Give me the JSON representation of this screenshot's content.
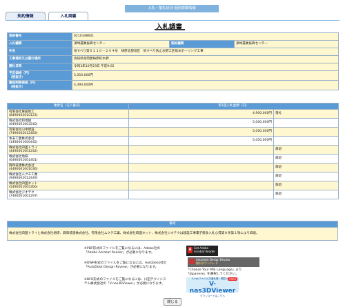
{
  "header": {
    "banner": "入札・落札状況-個別詳細情報"
  },
  "tabs": [
    {
      "label": "契約情報"
    },
    {
      "label": "入札調書"
    }
  ],
  "page_title": "入札調書",
  "info": {
    "contract_no_label": "契約番号",
    "contract_no": "0210348601",
    "bid_agency_label": "入札機関",
    "bid_agency": "須崎農業振興センター",
    "contract_agency_label": "契約機関",
    "contract_agency": "須崎農業振興センター",
    "project_label": "件名",
    "project": "地すべり第６２１０－２０４号　梼原北部地区　地すべり防止水野工区排水ボーリング工事",
    "location_label": "工事場所又は履行場所",
    "location": "高知県高岡郡梼原町水野",
    "opening_label": "開札日時",
    "opening": "令和3年10月29日 午前9:02",
    "planned_price_label": "予定価格（円）",
    "planned_price_sub": "（税抜き）",
    "planned_price": "5,050,000円",
    "min_price_label": "最低制限価格（円）",
    "min_price_sub": "（税抜き）",
    "min_price": "4,390,000円"
  },
  "bids": {
    "col_company": "業者名（法人番号）",
    "col_amount": "第1回入札金額（円）",
    "rows": [
      {
        "name": "有限会社東田地工",
        "corp": "(8490002010123)",
        "amount": "4,900,000円",
        "result": "落札"
      },
      {
        "name": "株式会社和地組",
        "corp": "(6490001003240)",
        "amount": "5,000,000円",
        "result": ""
      },
      {
        "name": "有限会社山中建設",
        "corp": "(7490002012483)",
        "amount": "5,000,000円",
        "result": ""
      },
      {
        "name": "本末工業株式会社",
        "corp": "(1490001000445)",
        "amount": "5,050,000円",
        "result": ""
      },
      {
        "name": "株式会社四国トライ",
        "corp": "(4490001001242)",
        "amount": "",
        "result": "辞退"
      },
      {
        "name": "株式会社地研",
        "corp": "(6490001001461)",
        "amount": "",
        "result": "辞退"
      },
      {
        "name": "興和技建株式会社",
        "corp": "(4490001001036)",
        "amount": "",
        "result": "辞退"
      },
      {
        "name": "株式会社ムクチ工業",
        "corp": "(9490002012449)",
        "amount": "",
        "result": "辞退"
      },
      {
        "name": "株式会社四国ネット",
        "corp": "(5490001005366)",
        "amount": "",
        "result": "辞退"
      },
      {
        "name": "株式会社ジオテク",
        "corp": "(7490001001297)",
        "amount": "",
        "result": "辞退"
      }
    ]
  },
  "remarks": {
    "label": "備考",
    "text": "株式会社四国トライと株式会社地研、興和技建株式会社、有限会社ムクチ工業、株式会社四国ネット、株式会社ジオテクは建設工事電子競争入札心得第８条第１項により辞退。"
  },
  "notes": {
    "pdf": [
      "※PDF形式のファイルをご覧になるには、Adobe社の",
      "「Adobe Acrobat Reader」が必要になります。"
    ],
    "dwf": [
      "※DWF形式のファイルをご覧になるには、AutoDesk社の",
      "「AutoDesk Design Review」が必要になります。"
    ],
    "bfo": [
      "※BFO形式のファイルをご覧になるには、川田テクノシス",
      "テム株式会社の「V-nas3DViewer」が必要になります。"
    ],
    "autodesk_extra": [
      "「Choose Your MSI Language」より",
      "「Japanese」を選択してください。"
    ]
  },
  "banners": {
    "adobe_l1": "Get Adobe",
    "adobe_l2": "Acrobat Reader",
    "adr_l1": "Autodesk Design Review",
    "adr_l2": "無料ダウンロード",
    "v3d_small": "V-nasファイル共通仕様・閲覧ソフト",
    "v3d_big": "V-nas3DViewer",
    "v3d_dl": "ダウンロードはこちら",
    "v3d_free": "FREE"
  },
  "close_button": "閉じる"
}
